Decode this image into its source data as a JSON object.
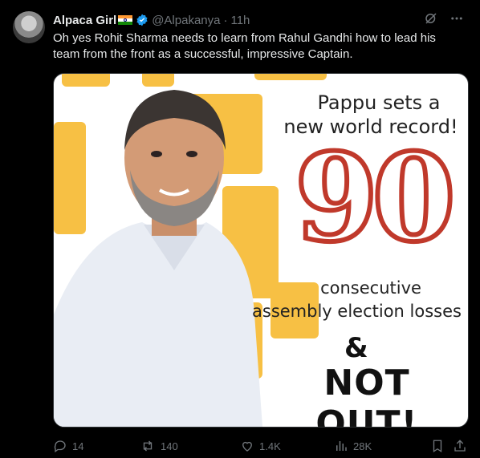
{
  "author": {
    "name": "Alpaca Girl",
    "handle": "@Alpakanya",
    "separator": "·",
    "time": "11h"
  },
  "tweet_text": "Oh yes Rohit Sharma needs to learn from Rahul Gandhi how to lead his team from the front as a successful, impressive Captain.",
  "image_text": {
    "headline_1": "Pappu sets a",
    "headline_2": "new world record!",
    "number": "90",
    "line_1": "consecutive",
    "line_2": "assembly election losses",
    "amp": "&",
    "not_out": "NOT OUT!"
  },
  "actions": {
    "replies": "14",
    "reposts": "140",
    "likes": "1.4K",
    "views": "28K"
  },
  "colors": {
    "verified": "#1d9bf0",
    "muted": "#71767b",
    "accent_yellow": "#f7c044"
  },
  "icons": [
    "grok-icon",
    "more-icon",
    "reply-icon",
    "repost-icon",
    "like-icon",
    "views-icon",
    "bookmark-icon",
    "share-icon"
  ]
}
